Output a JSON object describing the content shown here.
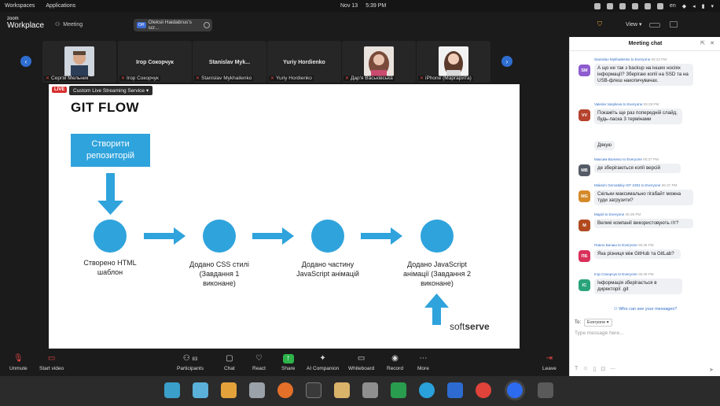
{
  "system": {
    "menu": [
      "Workspaces",
      "Applications"
    ],
    "date": "Nov 13",
    "time": "5:39 PM",
    "lang": "en"
  },
  "zoom": {
    "brand_top": "zoom",
    "brand_bottom": "Workplace",
    "meeting_label": "Meeting",
    "share_badge": "OH",
    "share_text": "Oleksii Haidabrus's scr...",
    "view_label": "View"
  },
  "participants": [
    {
      "name": "Сергій Мельник",
      "big": "",
      "photo": true
    },
    {
      "name": "Ігор Сокорчук",
      "big": "Ігор Сокорчук",
      "photo": false
    },
    {
      "name": "Stanislav Mykhailenko",
      "big": "Stanislav Myk...",
      "photo": false
    },
    {
      "name": "Yuriy Hordienko",
      "big": "Yuriy Hordienko",
      "photo": false
    },
    {
      "name": "Дар'я Васьківська",
      "big": "",
      "photo": true
    },
    {
      "name": "iPhone (Маргарита)",
      "big": "",
      "photo": true
    }
  ],
  "slide": {
    "live": "LIVE",
    "live_service": "Custom Live Streaming Service",
    "title": "GIT FLOW",
    "create_box": "Створити репозиторій",
    "steps": [
      "Створено HTML шаблон",
      "Додано CSS стилі (Завдання 1 виконане)",
      "Додано частину JavaScript анімацій",
      "Додано JavaScript анімації (Завдання 2 виконане)"
    ],
    "brand_light": "soft",
    "brand_bold": "serve",
    "accent": "#2fa3dc"
  },
  "toolbar": {
    "unmute": "Unmute",
    "start_video": "Start video",
    "participants": "Participants",
    "participants_count": "83",
    "chat": "Chat",
    "react": "React",
    "share": "Share",
    "companion": "AI Companion",
    "whiteboard": "Whiteboard",
    "record": "Record",
    "more": "More",
    "leave": "Leave"
  },
  "chat": {
    "title": "Meeting chat",
    "messages": [
      {
        "sender": "Stanislav Mykhailenko",
        "to": "to Everyone",
        "time": "05:22 PM",
        "initials": "SM",
        "color": "#8e5ccf",
        "text": "А що не так з backup на інших носіях інформації? Зберігаю копії на SSD та на USB-флеш накопичувачах."
      },
      {
        "sender": "Valeriia Vasylieva",
        "to": "to Everyone",
        "time": "05:29 PM",
        "initials": "VV",
        "color": "#b5432d",
        "text": "Покажіть ще раз попередній слайд, будь-ласка 3 термінами"
      },
      {
        "sender": "",
        "to": "",
        "time": "",
        "initials": "",
        "color": "",
        "text": "Дякую"
      },
      {
        "sender": "Максим Валигко",
        "to": "to Everyone",
        "time": "05:37 PM",
        "initials": "МВ",
        "color": "#555b66",
        "text": "де зберігаються копії версій"
      },
      {
        "sender": "Maksim Gervatskiy IST 2281",
        "to": "to Everyone",
        "time": "05:37 PM",
        "initials": "MG",
        "color": "#d58a2a",
        "text": "Скільки максимально гігабайт можна туди загрузити?"
      },
      {
        "sender": "Марія",
        "to": "to Everyone",
        "time": "05:38 PM",
        "initials": "М",
        "color": "#b24a1f",
        "text": "Великі компанії використовують гіт?"
      },
      {
        "sender": "Павло Бачиш",
        "to": "to Everyone",
        "time": "05:38 PM",
        "initials": "ПБ",
        "color": "#d8305a",
        "text": "Яка різниця між GitHub та GitLab?"
      },
      {
        "sender": "Ігор Сокорчук",
        "to": "to Everyone",
        "time": "05:39 PM",
        "initials": "ІС",
        "color": "#2aa37a",
        "text": "Інформація зберігається в директорії .git"
      }
    ],
    "who_can_see": "Who can see your messages?",
    "to_label": "To:",
    "to_value": "Everyone",
    "placeholder": "Type message here..."
  }
}
